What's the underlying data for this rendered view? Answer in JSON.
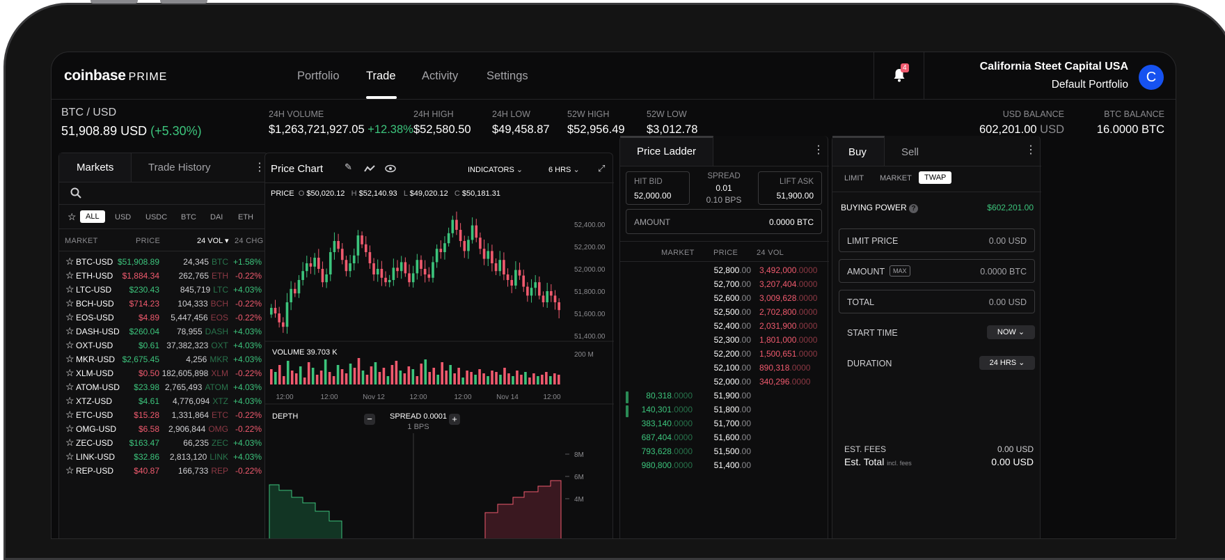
{
  "app": {
    "brand": "coinbase",
    "brand_suffix": "PRIME"
  },
  "nav": {
    "tabs": [
      "Portfolio",
      "Trade",
      "Activity",
      "Settings"
    ],
    "active": "Trade",
    "notifications": "4",
    "org_name": "California Steet Capital USA",
    "portfolio_name": "Default Portfolio",
    "avatar_letter": "C"
  },
  "ticker": {
    "pair": "BTC / USD",
    "price": "51,908.89 USD",
    "change": "(+5.30%)",
    "stats": [
      {
        "label": "24H VOLUME",
        "value": "$1,263,721,927.05",
        "delta": "+12.38%"
      },
      {
        "label": "24H HIGH",
        "value": "$52,580.50"
      },
      {
        "label": "24H LOW",
        "value": "$49,458.87"
      },
      {
        "label": "52W HIGH",
        "value": "$52,956.49"
      },
      {
        "label": "52W LOW",
        "value": "$3,012.78"
      }
    ],
    "usd_balance_label": "USD BALANCE",
    "usd_balance": "602,201.00",
    "usd_unit": "USD",
    "btc_balance_label": "BTC  BALANCE",
    "btc_balance": "16.0000 BTC"
  },
  "markets": {
    "tabs": [
      "Markets",
      "Trade History"
    ],
    "filters": [
      "ALL",
      "USD",
      "USDC",
      "BTC",
      "DAI",
      "ETH"
    ],
    "headers": [
      "MARKET",
      "PRICE",
      "24 VOL",
      "24 CHG"
    ],
    "rows": [
      {
        "sym": "BTC-USD",
        "price": "$51,908.89",
        "vol": "24,345",
        "unit": "BTC",
        "chg": "+1.58%",
        "up": true
      },
      {
        "sym": "ETH-USD",
        "price": "$1,884.34",
        "vol": "262,765",
        "unit": "ETH",
        "chg": "-0.22%",
        "up": false
      },
      {
        "sym": "LTC-USD",
        "price": "$230.43",
        "vol": "845,719",
        "unit": "LTC",
        "chg": "+4.03%",
        "up": true
      },
      {
        "sym": "BCH-USD",
        "price": "$714.23",
        "vol": "104,333",
        "unit": "BCH",
        "chg": "-0.22%",
        "up": false
      },
      {
        "sym": "EOS-USD",
        "price": "$4.89",
        "vol": "5,447,456",
        "unit": "EOS",
        "chg": "-0.22%",
        "up": false
      },
      {
        "sym": "DASH-USD",
        "price": "$260.04",
        "vol": "78,955",
        "unit": "DASH",
        "chg": "+4.03%",
        "up": true
      },
      {
        "sym": "OXT-USD",
        "price": "$0.61",
        "vol": "37,382,323",
        "unit": "OXT",
        "chg": "+4.03%",
        "up": true
      },
      {
        "sym": "MKR-USD",
        "price": "$2,675.45",
        "vol": "4,256",
        "unit": "MKR",
        "chg": "+4.03%",
        "up": true
      },
      {
        "sym": "XLM-USD",
        "price": "$0.50",
        "vol": "182,605,898",
        "unit": "XLM",
        "chg": "-0.22%",
        "up": false
      },
      {
        "sym": "ATOM-USD",
        "price": "$23.98",
        "vol": "2,765,493",
        "unit": "ATOM",
        "chg": "+4.03%",
        "up": true
      },
      {
        "sym": "XTZ-USD",
        "price": "$4.61",
        "vol": "4,776,094",
        "unit": "XTZ",
        "chg": "+4.03%",
        "up": true
      },
      {
        "sym": "ETC-USD",
        "price": "$15.28",
        "vol": "1,331,864",
        "unit": "ETC",
        "chg": "-0.22%",
        "up": false
      },
      {
        "sym": "OMG-USD",
        "price": "$6.58",
        "vol": "2,906,844",
        "unit": "OMG",
        "chg": "-0.22%",
        "up": false
      },
      {
        "sym": "ZEC-USD",
        "price": "$163.47",
        "vol": "66,235",
        "unit": "ZEC",
        "chg": "+4.03%",
        "up": true
      },
      {
        "sym": "LINK-USD",
        "price": "$32.86",
        "vol": "2,813,120",
        "unit": "LINK",
        "chg": "+4.03%",
        "up": true
      },
      {
        "sym": "REP-USD",
        "price": "$40.87",
        "vol": "166,733",
        "unit": "REP",
        "chg": "-0.22%",
        "up": false
      }
    ]
  },
  "price_chart": {
    "title": "Price Chart",
    "indicators": "INDICATORS",
    "interval": "6 HRS",
    "ohlc": {
      "label": "PRICE",
      "o": "$50,020.12",
      "h": "$52,140.93",
      "l": "$49,020.12",
      "c": "$50,181.31"
    },
    "volume_label": "VOLUME 39.703 K",
    "depth_label": "DEPTH",
    "spread": "SPREAD 0.0001",
    "spread_bps": "1 BPS"
  },
  "chart_data": {
    "type": "candlestick",
    "y_ticks": [
      "52,400.00",
      "52,200.00",
      "52,000.00",
      "51,800.00",
      "51,600.00",
      "51,400.00"
    ],
    "ylim": [
      51400,
      52500
    ],
    "volume_tick": "200 M",
    "x_ticks": [
      "12:00",
      "12:00",
      "Nov 12",
      "12:00",
      "12:00",
      "Nov 14",
      "12:00"
    ],
    "depth_ticks": [
      "8M",
      "6M",
      "4M"
    ],
    "closes": [
      51650,
      51600,
      51520,
      51480,
      51700,
      51820,
      51780,
      51900,
      51980,
      52050,
      52020,
      52100,
      52000,
      51880,
      51950,
      52150,
      52250,
      52180,
      52080,
      51980,
      52050,
      52120,
      52300,
      52220,
      52150,
      52050,
      51950,
      52000,
      51920,
      51880,
      51900,
      52010,
      51980,
      52060,
      51960,
      51880,
      51960,
      52080,
      52000,
      51950,
      51920,
      52060,
      52180,
      52150,
      52230,
      52320,
      52440,
      52350,
      52250,
      52160,
      52260,
      52390,
      52280,
      52180,
      52090,
      52160,
      52050,
      51980,
      52080,
      51950,
      51900,
      51850,
      51990,
      51940,
      51840,
      51760,
      51830,
      51880,
      51760,
      51700,
      51800,
      51760,
      51700,
      51630
    ],
    "volumes": [
      0.55,
      0.45,
      0.7,
      0.3,
      0.85,
      0.5,
      0.4,
      0.65,
      0.25,
      0.8,
      0.6,
      0.35,
      0.5,
      0.9,
      0.45,
      0.3,
      0.7,
      0.55,
      0.4,
      0.75,
      0.6,
      0.95,
      0.5,
      0.35,
      0.65,
      0.8,
      0.45,
      0.6,
      0.3,
      0.7,
      0.85,
      0.5,
      0.4,
      0.65,
      0.55,
      0.3,
      0.75,
      0.9,
      0.45,
      0.6,
      0.35,
      0.8,
      0.5,
      0.7,
      0.4,
      0.6,
      0.25,
      0.5,
      0.45,
      0.35,
      0.55,
      0.4,
      0.3,
      0.5,
      0.45,
      0.35,
      0.6,
      0.4,
      0.3,
      0.5,
      0.35,
      0.45,
      0.25,
      0.4,
      0.3,
      0.35,
      0.45,
      0.3,
      0.4,
      0.35
    ]
  },
  "ladder": {
    "title": "Price Ladder",
    "hit_bid_label": "HIT BID",
    "hit_bid": "52,000.00",
    "spread_label": "SPREAD",
    "spread": "0.01",
    "spread_bps": "0.10 BPS",
    "lift_ask_label": "LIFT ASK",
    "lift_ask": "51,900.00",
    "amount_label": "AMOUNT",
    "amount": "0.0000 BTC",
    "headers": [
      "MARKET",
      "PRICE",
      "24 VOL"
    ],
    "asks": [
      {
        "price": "52,800",
        "dec": ".00",
        "size": "3,492,000",
        "sdec": ".0000"
      },
      {
        "price": "52,700",
        "dec": ".00",
        "size": "3,207,404",
        "sdec": ".0000"
      },
      {
        "price": "52,600",
        "dec": ".00",
        "size": "3,009,628",
        "sdec": ".0000"
      },
      {
        "price": "52,500",
        "dec": ".00",
        "size": "2,702,800",
        "sdec": ".0000"
      },
      {
        "price": "52,400",
        "dec": ".00",
        "size": "2,031,900",
        "sdec": ".0000"
      },
      {
        "price": "52,300",
        "dec": ".00",
        "size": "1,801,000",
        "sdec": ".0000"
      },
      {
        "price": "52,200",
        "dec": ".00",
        "size": "1,500,651",
        "sdec": ".0000"
      },
      {
        "price": "52,100",
        "dec": ".00",
        "size": "890,318",
        "sdec": ".0000"
      },
      {
        "price": "52,000",
        "dec": ".00",
        "size": "340,296",
        "sdec": ".0000"
      }
    ],
    "bids": [
      {
        "size": "80,318",
        "sdec": ".0000",
        "price": "51,900",
        "dec": ".00"
      },
      {
        "size": "140,301",
        "sdec": ".0000",
        "price": "51,800",
        "dec": ".00"
      },
      {
        "size": "383,140",
        "sdec": ".0000",
        "price": "51,700",
        "dec": ".00"
      },
      {
        "size": "687,404",
        "sdec": ".0000",
        "price": "51,600",
        "dec": ".00"
      },
      {
        "size": "793,628",
        "sdec": ".0000",
        "price": "51,500",
        "dec": ".00"
      },
      {
        "size": "980,800",
        "sdec": ".0000",
        "price": "51,400",
        "dec": ".00"
      }
    ]
  },
  "order": {
    "tabs": [
      "Buy",
      "Sell"
    ],
    "types": [
      "LIMIT",
      "MARKET",
      "TWAP"
    ],
    "active_type": "TWAP",
    "buying_power_label": "BUYING POWER",
    "buying_power": "$602,201.00",
    "limit_price_label": "LIMIT PRICE",
    "limit_price": "0.00 USD",
    "amount_label": "AMOUNT",
    "max": "MAX",
    "amount": "0.0000 BTC",
    "total_label": "TOTAL",
    "total": "0.00 USD",
    "start_time_label": "START TIME",
    "start_time": "NOW",
    "duration_label": "DURATION",
    "duration": "24 HRS",
    "fees_label": "EST. FEES",
    "fees": "0.00 USD",
    "est_total_label": "Est. Total",
    "est_total_note": "incl. fees",
    "est_total": "0.00 USD"
  }
}
